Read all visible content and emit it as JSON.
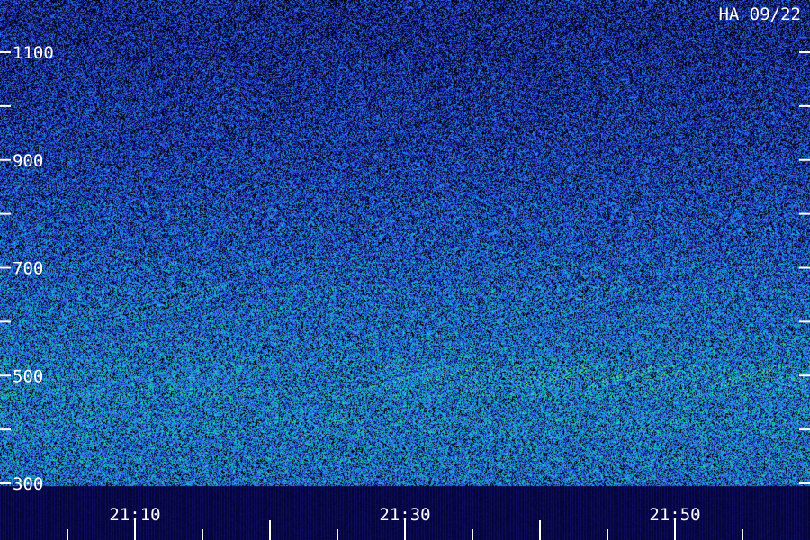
{
  "chart_data": {
    "type": "heatmap",
    "title": "HA 09/22",
    "xlabel": "",
    "ylabel": "",
    "x_range": [
      "21:02",
      "21:59"
    ],
    "x_major_ticks": [
      "21:10",
      "21:30",
      "21:50"
    ],
    "y_range": [
      300,
      1150
    ],
    "y_major_ticks": [
      300,
      500,
      700,
      900,
      1100
    ],
    "y_minor_ticks": [
      400,
      600,
      800,
      1000
    ],
    "colormap": [
      "#000000",
      "#1a1aa8",
      "#3050e0",
      "#20a0e0",
      "#20e0a0",
      "#a0ff40"
    ],
    "band_intensity_by_frequency": [
      {
        "freq": 1150,
        "level": 0.3
      },
      {
        "freq": 1000,
        "level": 0.35
      },
      {
        "freq": 850,
        "level": 0.42
      },
      {
        "freq": 700,
        "level": 0.5
      },
      {
        "freq": 600,
        "level": 0.56
      },
      {
        "freq": 500,
        "level": 0.6
      },
      {
        "freq": 400,
        "level": 0.6
      },
      {
        "freq": 300,
        "level": 0.56
      }
    ]
  }
}
